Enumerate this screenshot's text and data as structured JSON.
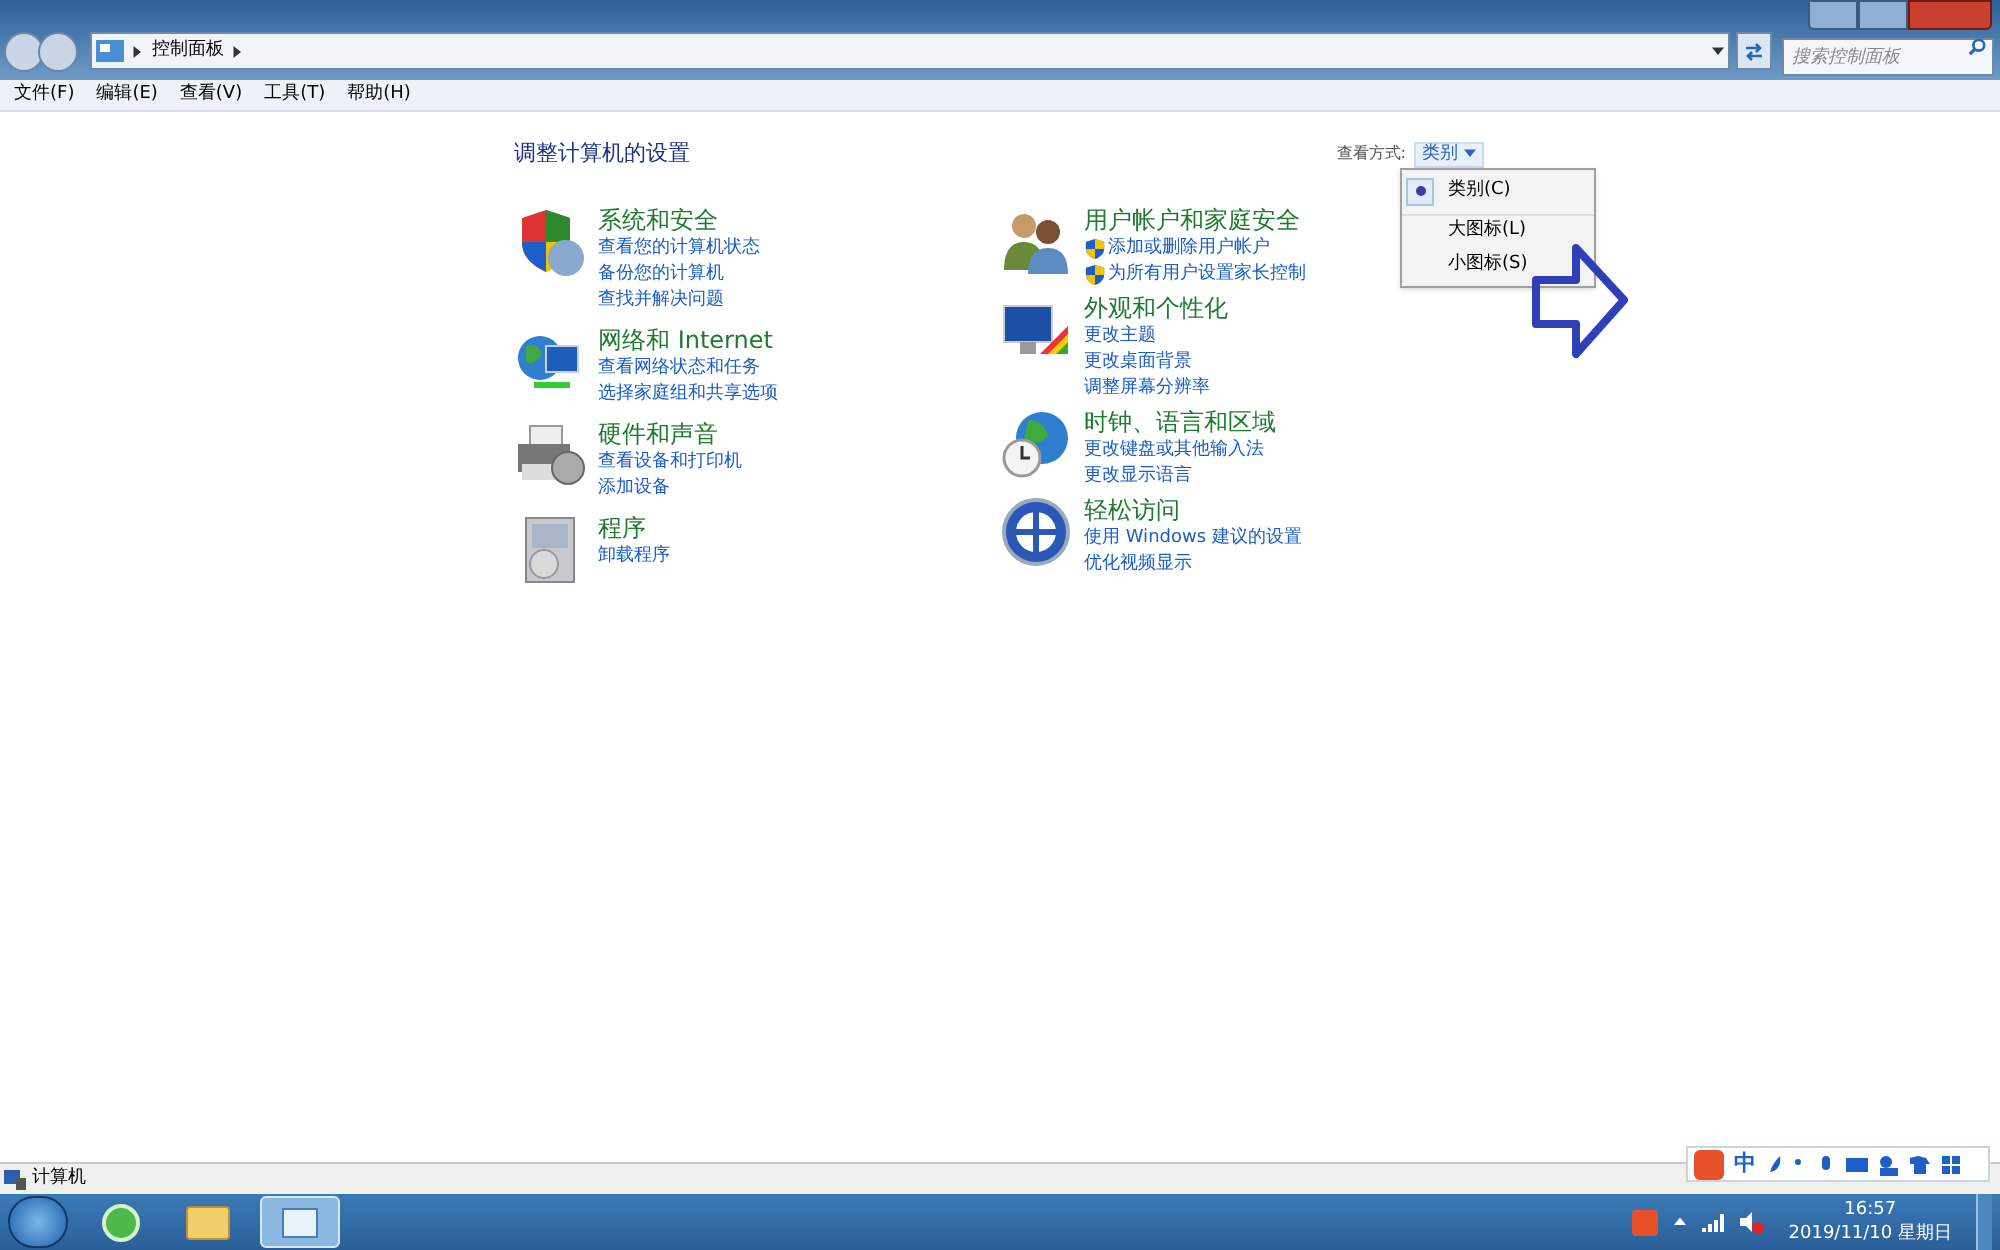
{
  "address_bar": {
    "path": [
      "控制面板"
    ],
    "search_placeholder": "搜索控制面板"
  },
  "menu_bar": [
    "文件(F)",
    "编辑(E)",
    "查看(V)",
    "工具(T)",
    "帮助(H)"
  ],
  "page_title": "调整计算机的设置",
  "view_by": {
    "label": "查看方式:",
    "value": "类别",
    "menu": [
      {
        "label": "类别(C)",
        "selected": true
      },
      {
        "label": "大图标(L)",
        "selected": false
      },
      {
        "label": "小图标(S)",
        "selected": false
      }
    ]
  },
  "columns": [
    [
      {
        "kind": "shield",
        "title": "系统和安全",
        "links": [
          {
            "text": "查看您的计算机状态",
            "shield": false
          },
          {
            "text": "备份您的计算机",
            "shield": false
          },
          {
            "text": "查找并解决问题",
            "shield": false
          }
        ]
      },
      {
        "kind": "network",
        "title": "网络和 Internet",
        "links": [
          {
            "text": "查看网络状态和任务",
            "shield": false
          },
          {
            "text": "选择家庭组和共享选项",
            "shield": false
          }
        ]
      },
      {
        "kind": "printer",
        "title": "硬件和声音",
        "links": [
          {
            "text": "查看设备和打印机",
            "shield": false
          },
          {
            "text": "添加设备",
            "shield": false
          }
        ]
      },
      {
        "kind": "programs",
        "title": "程序",
        "links": [
          {
            "text": "卸载程序",
            "shield": false
          }
        ]
      }
    ],
    [
      {
        "kind": "users",
        "title": "用户帐户和家庭安全",
        "links": [
          {
            "text": "添加或删除用户帐户",
            "shield": true
          },
          {
            "text": "为所有用户设置家长控制",
            "shield": true
          }
        ]
      },
      {
        "kind": "display",
        "title": "外观和个性化",
        "links": [
          {
            "text": "更改主题",
            "shield": false
          },
          {
            "text": "更改桌面背景",
            "shield": false
          },
          {
            "text": "调整屏幕分辨率",
            "shield": false
          }
        ]
      },
      {
        "kind": "globe",
        "title": "时钟、语言和区域",
        "links": [
          {
            "text": "更改键盘或其他输入法",
            "shield": false
          },
          {
            "text": "更改显示语言",
            "shield": false
          }
        ]
      },
      {
        "kind": "access",
        "title": "轻松访问",
        "links": [
          {
            "text": "使用 Windows 建议的设置",
            "shield": false
          },
          {
            "text": "优化视频显示",
            "shield": false
          }
        ]
      }
    ]
  ],
  "status_bar": {
    "text": "计算机"
  },
  "ime_bar": {
    "mode": "中"
  },
  "taskbar": {
    "time": "16:57",
    "date": "2019/11/10 星期日"
  }
}
